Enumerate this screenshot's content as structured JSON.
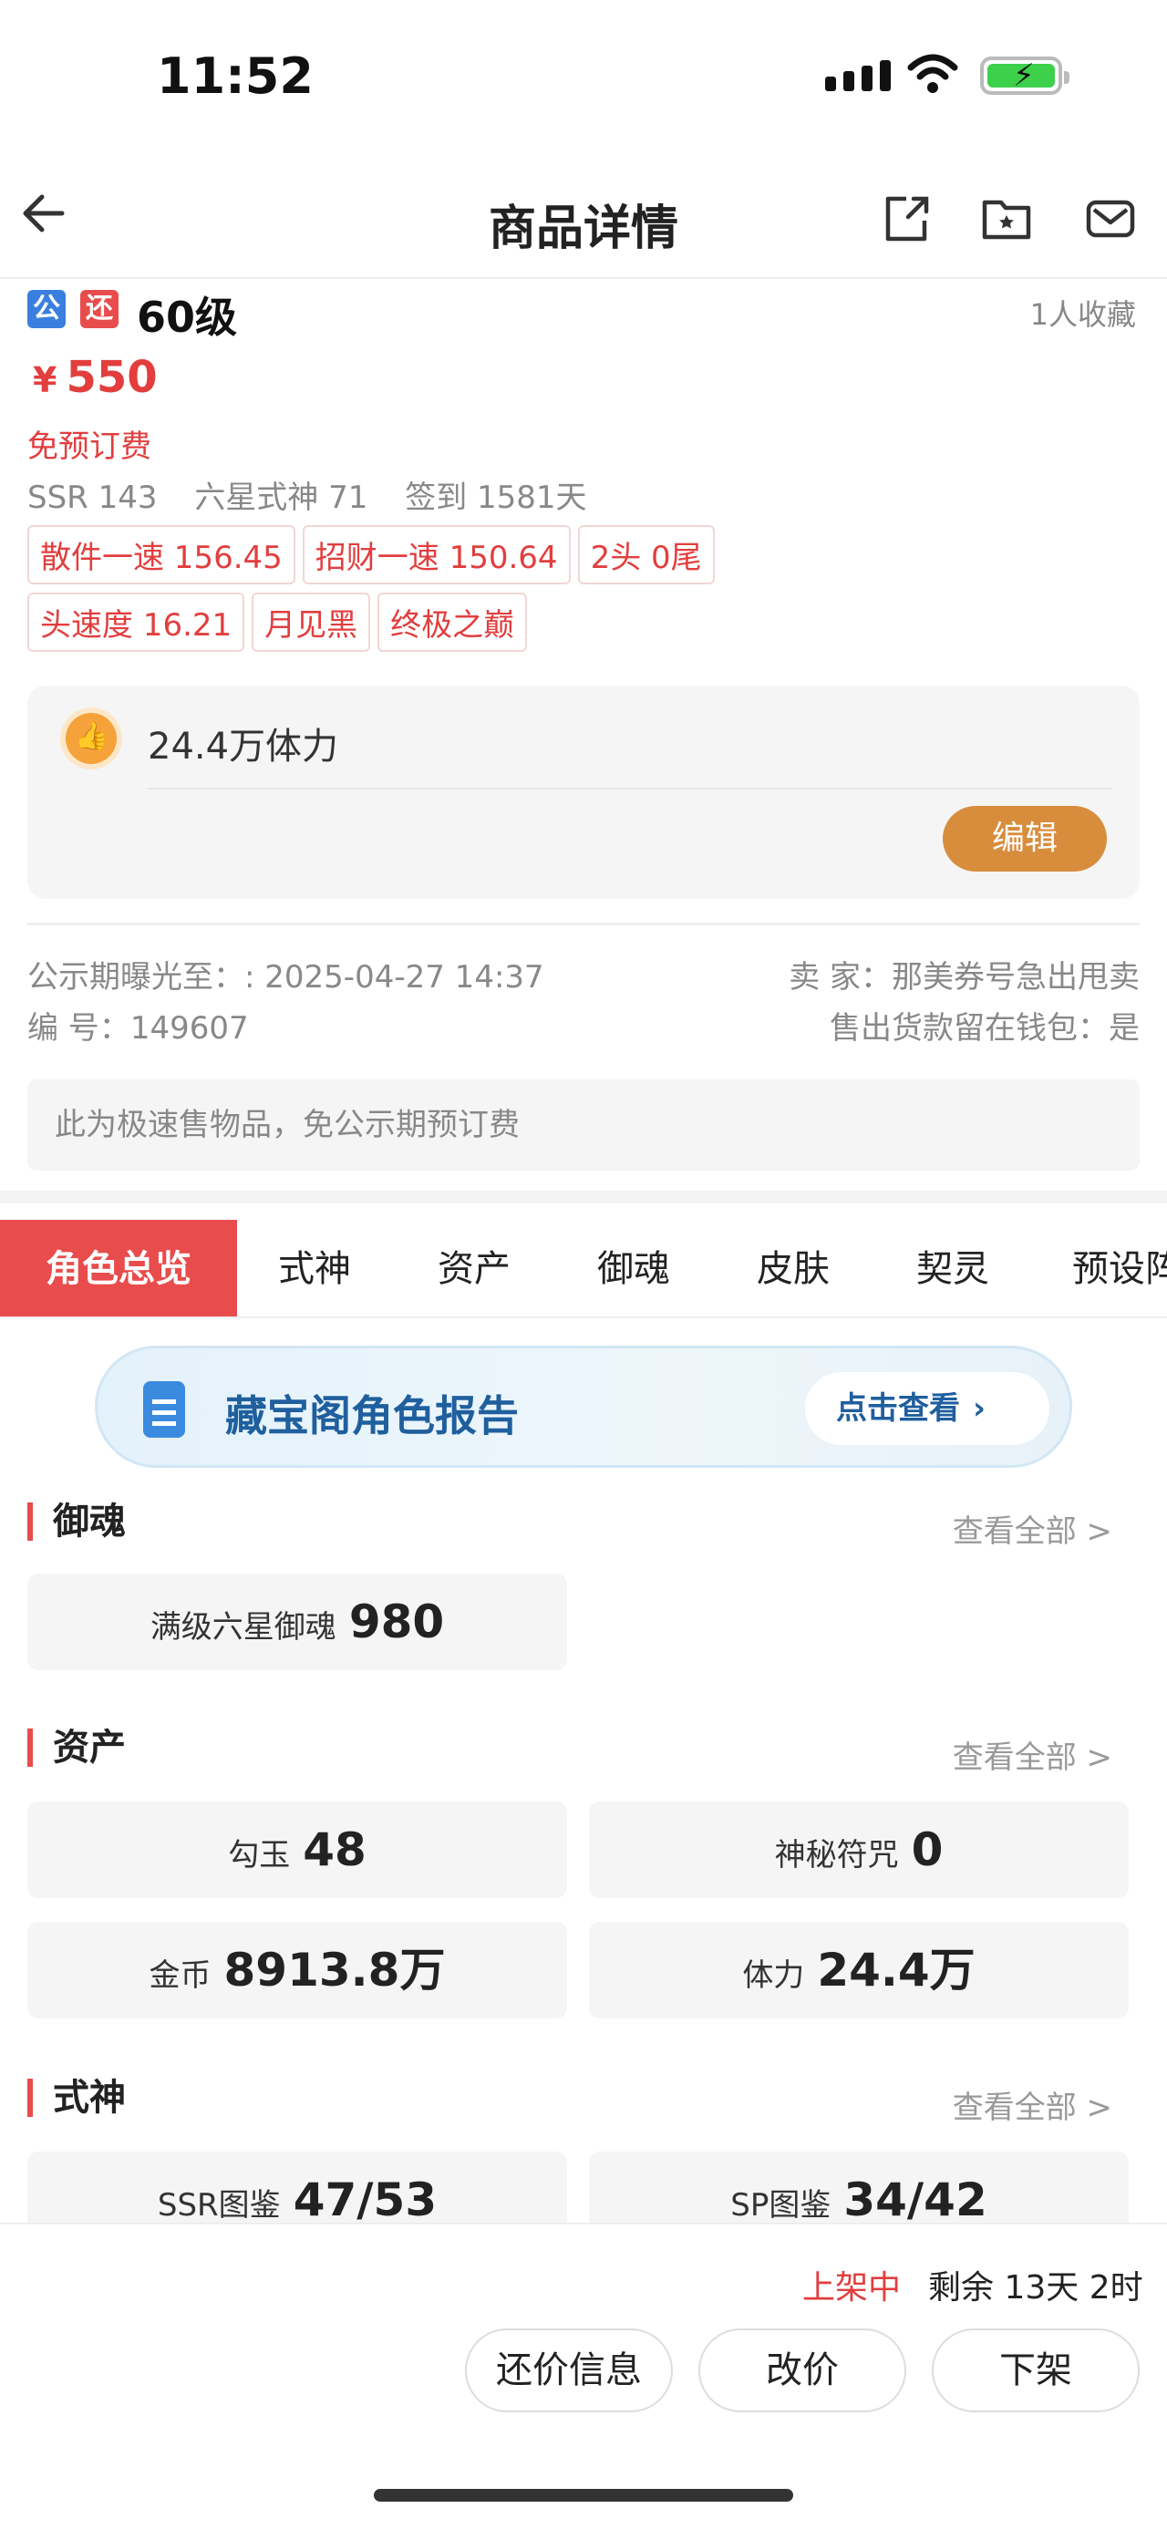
{
  "status_bar": {
    "time": "11:52"
  },
  "header": {
    "title": "商品详情"
  },
  "item": {
    "badge_public": "公",
    "badge_return": "还",
    "level": "60级",
    "favorites": "1人收藏",
    "price_symbol": "¥",
    "price": "550",
    "fee_note": "免预订费",
    "stats": [
      "SSR 143",
      "六星式神 71",
      "签到 1581天"
    ],
    "tags_row1": [
      "散件一速 156.45",
      "招财一速 150.64",
      "2头 0尾"
    ],
    "tags_row2": [
      "头速度 16.21",
      "月见黑",
      "终极之巅"
    ]
  },
  "stamina_card": {
    "text": "24.4万体力",
    "edit_label": "编辑"
  },
  "meta": {
    "public_until_label": "公示期曝光至：:",
    "public_until_value": "2025-04-27 14:37",
    "seller_label": "卖 家：",
    "seller_value": "那美券号急出甩卖",
    "number_label": "编 号：",
    "number_value": "149607",
    "wallet_label": "售出货款留在钱包：",
    "wallet_value": "是"
  },
  "notice": "此为极速售物品，免公示期预订费",
  "tabs": [
    "角色总览",
    "式神",
    "资产",
    "御魂",
    "皮肤",
    "契灵",
    "预设阵"
  ],
  "banner": {
    "title": "藏宝阁角色报告",
    "button": "点击查看",
    "chevron": "›"
  },
  "sections": {
    "yuhun": {
      "title": "御魂",
      "more": "查看全部 >",
      "items": [
        {
          "label": "满级六星御魂",
          "value": "980"
        }
      ]
    },
    "assets": {
      "title": "资产",
      "more": "查看全部 >",
      "items": [
        {
          "label": "勾玉",
          "value": "48"
        },
        {
          "label": "神秘符咒",
          "value": "0"
        },
        {
          "label": "金币",
          "value": "8913.8万"
        },
        {
          "label": "体力",
          "value": "24.4万"
        }
      ]
    },
    "shikigami": {
      "title": "式神",
      "more": "查看全部 >",
      "items": [
        {
          "label": "SSR图鉴",
          "value": "47/53"
        },
        {
          "label": "SP图鉴",
          "value": "34/42"
        }
      ]
    }
  },
  "bottom_bar": {
    "status": "上架中",
    "remaining": "剩余 13天 2时",
    "buttons": [
      "还价信息",
      "改价",
      "下架"
    ]
  },
  "colors": {
    "accent_red": "#e84c4c",
    "price_red": "#e23e3e",
    "edit_orange": "#d88d3d",
    "banner_blue": "#1f5f9e"
  }
}
